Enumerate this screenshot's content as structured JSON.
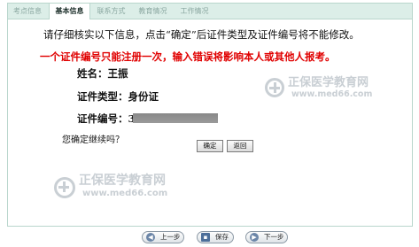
{
  "tabs": [
    {
      "label": "考点信息",
      "active": false
    },
    {
      "label": "基本信息",
      "active": true
    },
    {
      "label": "联系方式",
      "active": false
    },
    {
      "label": "教育情况",
      "active": false
    },
    {
      "label": "工作情况",
      "active": false
    }
  ],
  "content": {
    "intro": "请仔细核实以下信息，点击“确定”后证件类型及证件编号将不能修改。",
    "warning": "一个证件编号只能注册一次，输入错误将影响本人或其他人报考。",
    "name_field": "姓名：王振",
    "id_type_field": "证件类型：身份证",
    "id_number_field": "证件编号：3",
    "confirm_question": "您确定继续吗？"
  },
  "dialog_buttons": {
    "ok": "确定",
    "back": "返回"
  },
  "watermark": {
    "brand": "正保医学教育网",
    "url": "www.med66.com"
  },
  "bottom_nav": {
    "prev": "上一步",
    "save": "保存",
    "next": "下一步"
  },
  "colors": {
    "accent": "#dceee8",
    "warning": "#e00000",
    "watermark": "#c9cfd4"
  }
}
